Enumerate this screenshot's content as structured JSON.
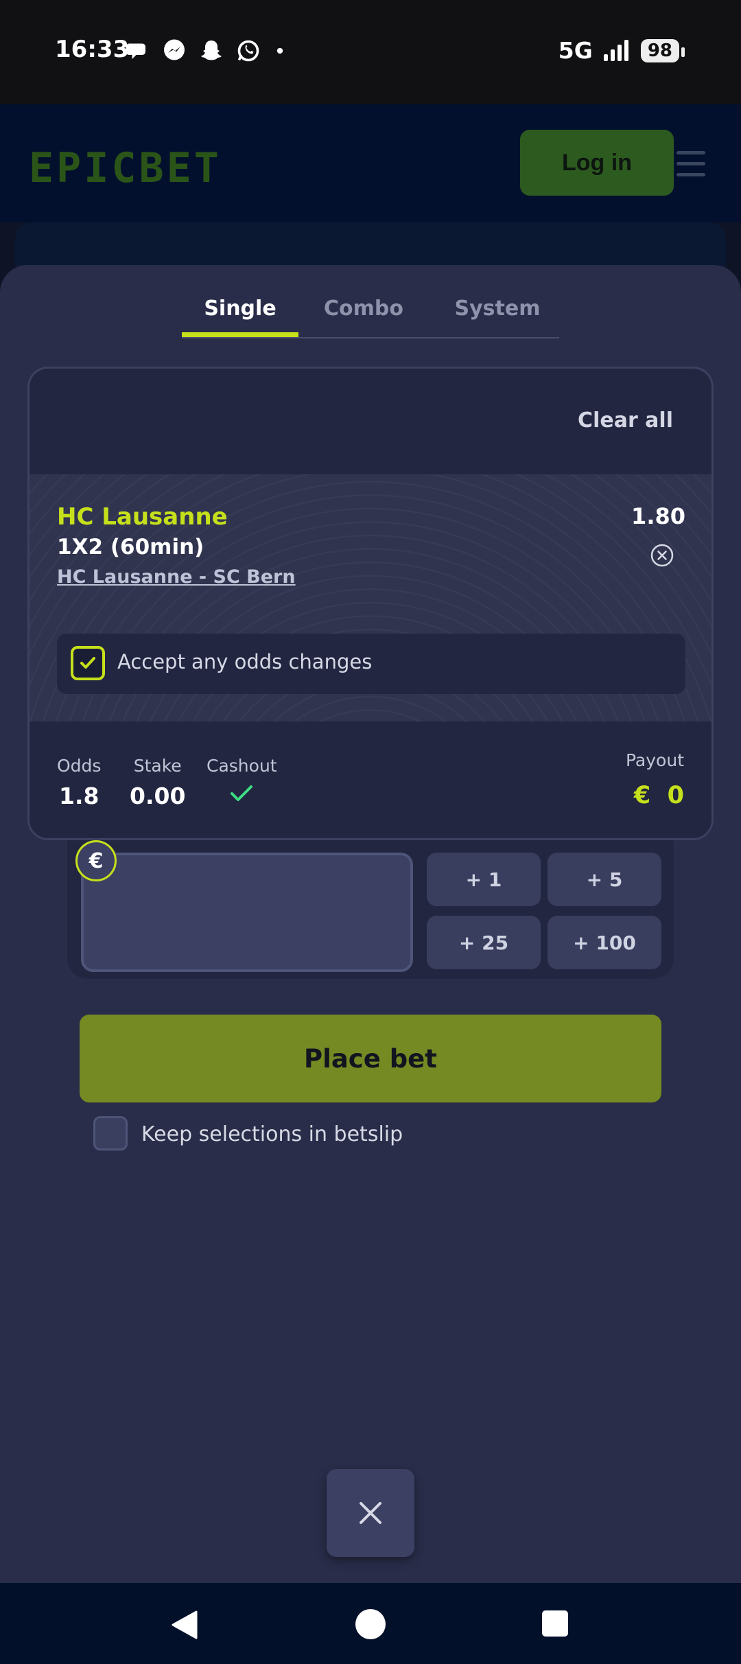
{
  "status_bar": {
    "time": "16:33",
    "network": "5G",
    "battery": "98",
    "notification_icons": [
      "chat-bubble-icon",
      "messenger-icon",
      "snapchat-icon",
      "whatsapp-icon",
      "dot-icon"
    ]
  },
  "header": {
    "logo": "EPICBET",
    "login_label": "Log in"
  },
  "betslip": {
    "tabs": [
      {
        "label": "Single",
        "active": true
      },
      {
        "label": "Combo",
        "active": false
      },
      {
        "label": "System",
        "active": false
      }
    ],
    "clear_all_label": "Clear all",
    "selection": {
      "team": "HC Lausanne",
      "market": "1X2 (60min)",
      "match": "HC Lausanne - SC Bern",
      "odds": "1.80"
    },
    "accept_odds_label": "Accept any odds changes",
    "summary": {
      "odds_label": "Odds",
      "odds_value": "1.8",
      "stake_label": "Stake",
      "stake_value": "0.00",
      "cashout_label": "Cashout",
      "payout_label": "Payout",
      "payout_currency": "€",
      "payout_value": "0"
    },
    "stake_input": {
      "currency": "€",
      "value": ""
    },
    "quick_stakes": [
      "+ 1",
      "+ 5",
      "+ 25",
      "+ 100"
    ],
    "place_bet_label": "Place bet",
    "keep_selections_label": "Keep selections in betslip"
  },
  "colors": {
    "accent": "#c6e01b",
    "place_bet_bg": "#768a23",
    "sheet_bg": "#292d49",
    "cashout_check": "#3ddc84"
  }
}
